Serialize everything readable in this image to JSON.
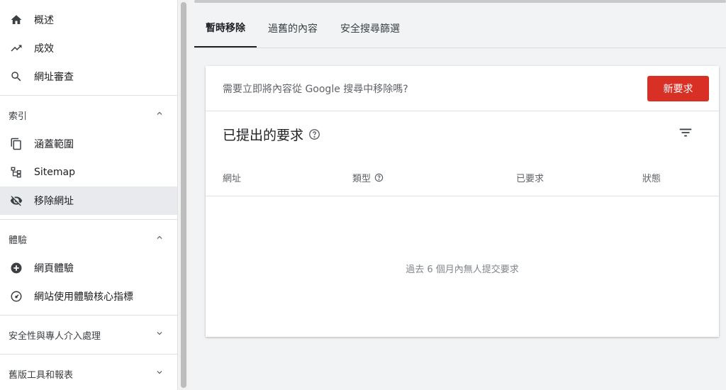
{
  "sidebar": {
    "top_items": [
      {
        "label": "概述",
        "icon": "home-icon"
      },
      {
        "label": "成效",
        "icon": "trending-up-icon"
      },
      {
        "label": "網址審查",
        "icon": "search-icon"
      }
    ],
    "index": {
      "header": "索引",
      "items": [
        {
          "label": "涵蓋範圍",
          "icon": "copy-icon"
        },
        {
          "label": "Sitemap",
          "icon": "sitemap-icon"
        },
        {
          "label": "移除網址",
          "icon": "eye-off-icon",
          "active": true
        }
      ]
    },
    "experience": {
      "header": "體驗",
      "items": [
        {
          "label": "網頁體驗",
          "icon": "plus-circle-icon"
        },
        {
          "label": "網站使用體驗核心指標",
          "icon": "speedometer-icon"
        }
      ]
    },
    "security_header": "安全性與專人介入處理",
    "legacy_header": "舊版工具和報表"
  },
  "tabs": [
    {
      "label": "暫時移除",
      "active": true
    },
    {
      "label": "過舊的內容"
    },
    {
      "label": "安全搜尋篩選"
    }
  ],
  "card": {
    "question": "需要立即將內容從 Google 搜尋中移除嗎?",
    "new_request_label": "新要求",
    "submitted_title": "已提出的要求",
    "columns": {
      "url": "網址",
      "type": "類型",
      "requested": "已要求",
      "status": "狀態"
    },
    "empty_message": "過去 6 個月內無人提交要求"
  },
  "colors": {
    "accent_red": "#d93025",
    "active_nav_bg": "#e8eaed"
  }
}
